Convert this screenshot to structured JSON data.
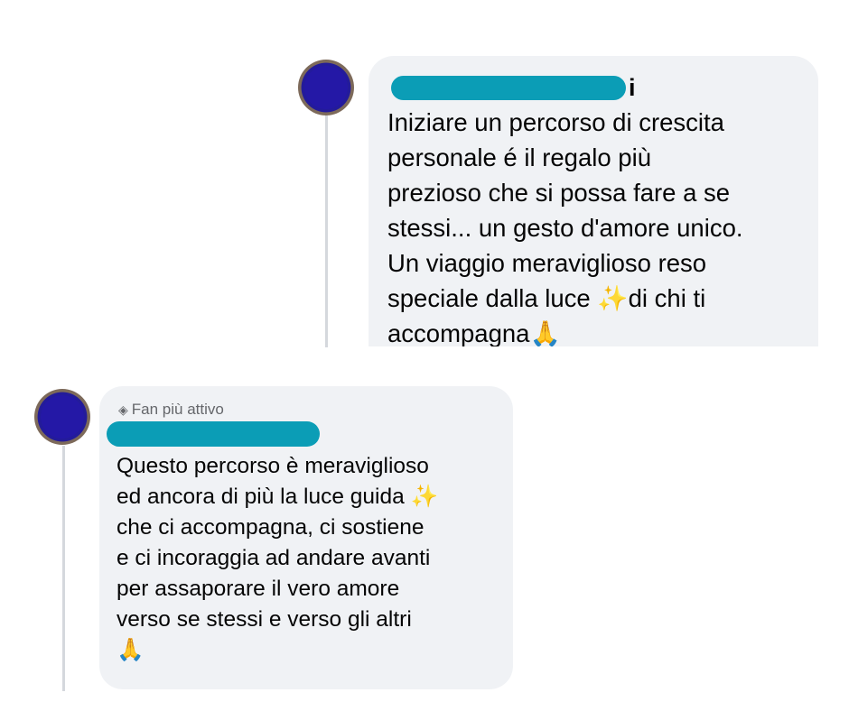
{
  "comments": [
    {
      "author_visible_suffix": "i",
      "text": "Iniziare un percorso di crescita\npersonale é il  regalo più\nprezioso che si possa fare a se\nstessi... un gesto d'amore unico.\nUn viaggio meraviglioso reso\nspeciale dalla luce ✨di chi ti\naccompagna🙏"
    },
    {
      "badge_icon": "diamond-icon",
      "badge_label": "Fan più attivo",
      "text": "Questo percorso è meraviglioso\ned ancora di più la luce guida ✨\nche ci accompagna, ci sostiene\ne ci incoraggia ad andare avanti\nper assaporare il vero amore\nverso se stessi e verso gli altri\n🙏"
    }
  ],
  "colors": {
    "bubble": "#f0f2f5",
    "redaction": "#0b9db6",
    "thread_line": "#d5d8dd",
    "avatar_fill": "#2418a6"
  }
}
